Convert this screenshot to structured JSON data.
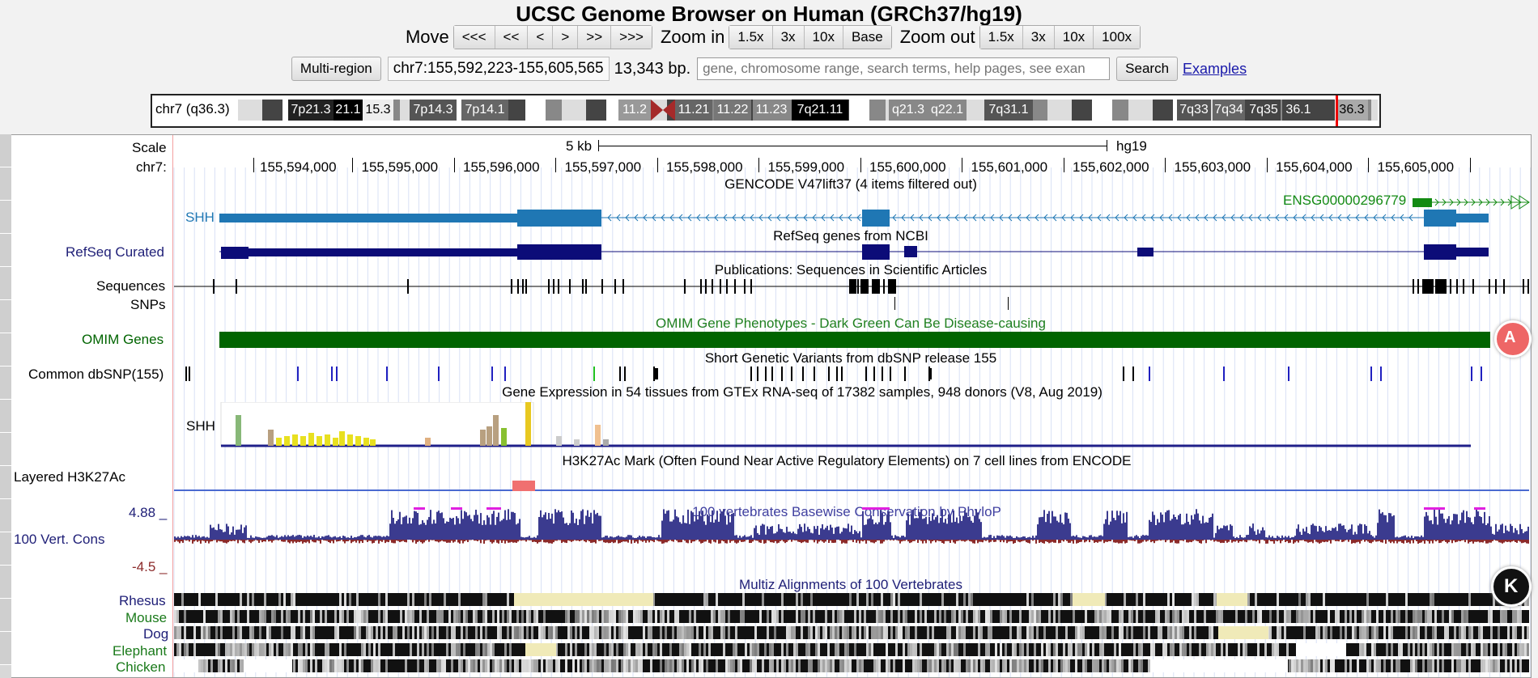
{
  "header": {
    "title": "UCSC Genome Browser on Human (GRCh37/hg19)"
  },
  "nav": {
    "move_label": "Move",
    "move_buttons": [
      "<<<",
      "<<",
      "<",
      ">",
      ">>",
      ">>>"
    ],
    "zoom_in_label": "Zoom in",
    "zoom_in_buttons": [
      "1.5x",
      "3x",
      "10x",
      "Base"
    ],
    "zoom_out_label": "Zoom out",
    "zoom_out_buttons": [
      "1.5x",
      "3x",
      "10x",
      "100x"
    ]
  },
  "position": {
    "multi_region": "Multi-region",
    "value": "chr7:155,592,223-155,605,565",
    "size": "13,343 bp.",
    "search_placeholder": "gene, chromosome range, search terms, help pages, see exan",
    "search_button": "Search",
    "examples_link": "Examples"
  },
  "ideogram": {
    "chrom_label": "chr7 (q36.3)",
    "bands": [
      "7p21.3",
      "21.1",
      "15.3",
      "7p14.3",
      "7p14.1",
      "11.2",
      "11.21",
      "11.22",
      "11.23",
      "7q21.11",
      "q21.3",
      "q22.1",
      "7q31.1",
      "7q33",
      "7q34",
      "7q35",
      "36.1",
      "36.3"
    ]
  },
  "scale": {
    "label": "Scale",
    "chr_label": "chr7:",
    "bar_label": "5 kb",
    "assembly": "hg19",
    "ticks": [
      "155,594,000",
      "155,595,000",
      "155,596,000",
      "155,597,000",
      "155,598,000",
      "155,599,000",
      "155,600,000",
      "155,601,000",
      "155,602,000",
      "155,603,000",
      "155,604,000",
      "155,605,000"
    ]
  },
  "tracks": {
    "gencode_title": "GENCODE V47lift37 (4 items filtered out)",
    "gencode_gene": "SHH",
    "gencode_gene2": "ENSG00000296779",
    "refseq_label": "RefSeq Curated",
    "refseq_title": "RefSeq genes from NCBI",
    "pubs_title": "Publications: Sequences in Scientific Articles",
    "sequences_label": "Sequences",
    "snps_label": "SNPs",
    "omim_label": "OMIM Genes",
    "omim_title": "OMIM Gene Phenotypes - Dark Green Can Be Disease-causing",
    "dbsnp_label": "Common dbSNP(155)",
    "dbsnp_title": "Short Genetic Variants from dbSNP release 155",
    "gtex_title": "Gene Expression in 54 tissues from GTEx RNA-seq of 17382 samples, 948 donors (V8, Aug 2019)",
    "gtex_gene": "SHH",
    "h3k27ac_label": "Layered H3K27Ac",
    "h3k27ac_title": "H3K27Ac Mark (Often Found Near Active Regulatory Elements) on 7 cell lines from ENCODE",
    "cons_label": "100 Vert. Cons",
    "cons_max": "4.88 _",
    "cons_min": "-4.5 _",
    "cons_title": "100 vertebrates Basewise Conservation by PhyloP",
    "multiz_title": "Multiz Alignments of 100 Vertebrates",
    "species": [
      "Rhesus",
      "Mouse",
      "Dog",
      "Elephant",
      "Chicken"
    ]
  },
  "colors": {
    "gencode": "#1f77b4",
    "refseq": "#0c0c78",
    "omim": "#006400",
    "cons_pos": "#3b3b8f",
    "cons_neg": "#8b2a2a"
  }
}
